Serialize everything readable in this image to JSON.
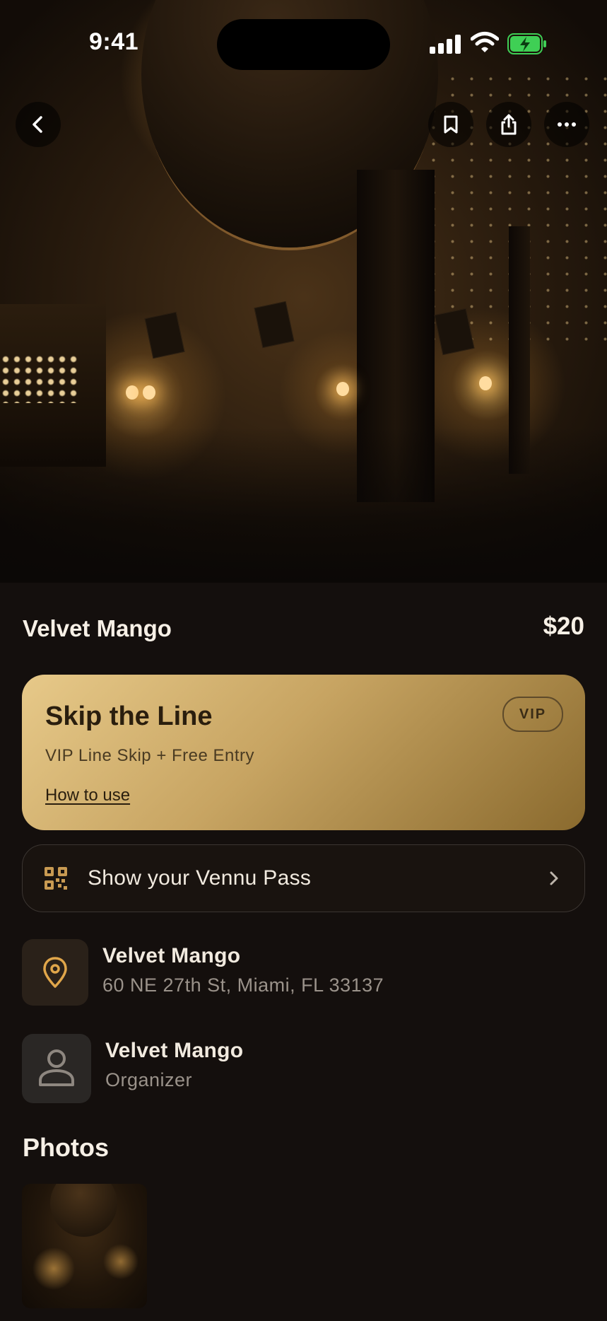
{
  "status_bar": {
    "time": "9:41"
  },
  "event": {
    "title": "Velvet Mango",
    "price": "$20"
  },
  "offer_card": {
    "title": "Skip the Line",
    "subtitle": "VIP Line Skip + Free Entry",
    "link": "How to use",
    "badge": "VIP"
  },
  "pass_button": {
    "label": "Show your Vennu Pass"
  },
  "location": {
    "name": "Velvet Mango",
    "address": "60 NE 27th St, Miami, FL 33137"
  },
  "organizer": {
    "name": "Velvet Mango",
    "role": "Organizer"
  },
  "photos": {
    "heading": "Photos"
  },
  "colors": {
    "background": "#140f0d",
    "accent_gold": "#c7a462",
    "battery_green": "#3fcf55",
    "location_icon": "#e0a64a"
  },
  "icons": [
    "back-arrow-icon",
    "bookmark-icon",
    "share-icon",
    "more-icon",
    "qr-code-icon",
    "chevron-right-icon",
    "location-pin-icon",
    "person-icon"
  ]
}
